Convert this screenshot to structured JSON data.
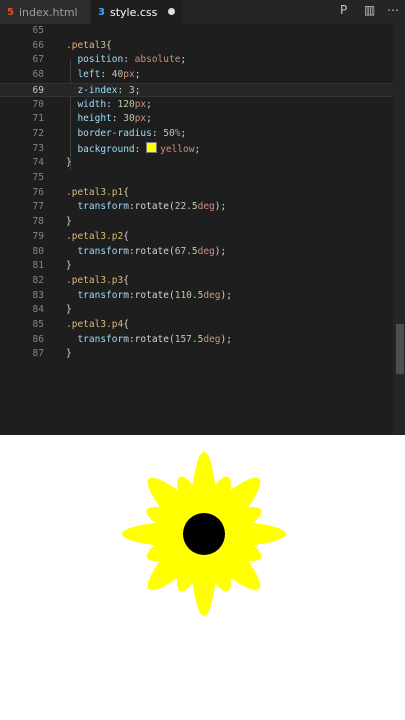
{
  "tabs": [
    {
      "label": "index.html",
      "icon": "html5-icon"
    },
    {
      "label": "style.css",
      "icon": "css3-icon"
    }
  ],
  "toolbar": {
    "preview_icon": "preview-icon",
    "split_icon": "split-editor-icon",
    "more_icon": "more-actions-icon"
  },
  "editor": {
    "active_line": 69,
    "lines": [
      {
        "n": "65",
        "text": ""
      },
      {
        "n": "66",
        "text": ".petal3{"
      },
      {
        "n": "67",
        "text": "  position: absolute;"
      },
      {
        "n": "68",
        "text": "  left: 40px;"
      },
      {
        "n": "69",
        "text": "  z-index: 3;"
      },
      {
        "n": "70",
        "text": "  width: 120px;"
      },
      {
        "n": "71",
        "text": "  height: 30px;"
      },
      {
        "n": "72",
        "text": "  border-radius: 50%;"
      },
      {
        "n": "73",
        "text": "  background: yellow;"
      },
      {
        "n": "74",
        "text": "}"
      },
      {
        "n": "75",
        "text": ""
      },
      {
        "n": "76",
        "text": ".petal3.p1{"
      },
      {
        "n": "77",
        "text": "  transform:rotate(22.5deg);"
      },
      {
        "n": "78",
        "text": "}"
      },
      {
        "n": "79",
        "text": ".petal3.p2{"
      },
      {
        "n": "80",
        "text": "  transform:rotate(67.5deg);"
      },
      {
        "n": "81",
        "text": "}"
      },
      {
        "n": "82",
        "text": ".petal3.p3{"
      },
      {
        "n": "83",
        "text": "  transform:rotate(110.5deg);"
      },
      {
        "n": "84",
        "text": "}"
      },
      {
        "n": "85",
        "text": ".petal3.p4{"
      },
      {
        "n": "86",
        "text": "  transform:rotate(157.5deg);"
      },
      {
        "n": "87",
        "text": "}"
      }
    ]
  },
  "preview": {
    "petal_color": "#ffff00",
    "center_color": "#000000"
  }
}
